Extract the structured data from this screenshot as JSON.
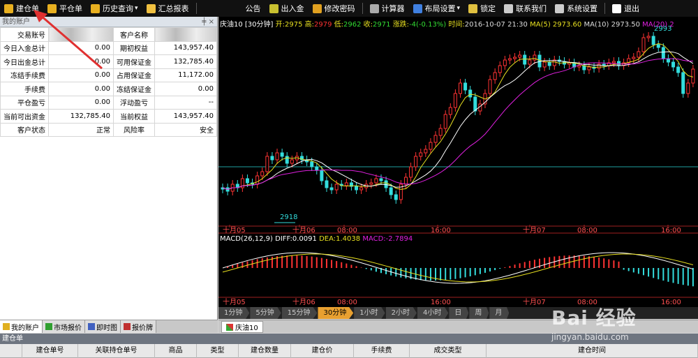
{
  "toolbar": {
    "items": [
      {
        "label": "建仓单",
        "icon": "box-icon",
        "color": "#e8b020"
      },
      {
        "label": "平仓单",
        "icon": "cart-icon",
        "color": "#e8b020"
      },
      {
        "label": "历史查询",
        "icon": "bar-chart-icon",
        "color": "#e8b020",
        "dropdown": "▾"
      },
      {
        "label": "汇总报表",
        "icon": "report-icon",
        "color": "#f0c040"
      },
      {
        "label": "公告",
        "icon": "",
        "color": ""
      },
      {
        "label": "出入金",
        "icon": "money-icon",
        "color": "#c8c030"
      },
      {
        "label": "修改密码",
        "icon": "key-icon",
        "color": "#e0a020"
      },
      {
        "label": "计算器",
        "icon": "calculator-icon",
        "color": "#aaaaaa"
      },
      {
        "label": "布局设置",
        "icon": "layout-icon",
        "color": "#4080e0",
        "dropdown": "▾"
      },
      {
        "label": "锁定",
        "icon": "lock-icon",
        "color": "#e0c040"
      },
      {
        "label": "联系我们",
        "icon": "phone-icon",
        "color": "#cccccc"
      },
      {
        "label": "系统设置",
        "icon": "gear-icon",
        "color": "#cccccc"
      },
      {
        "label": "退出",
        "icon": "power-icon",
        "color": "#ffffff"
      }
    ]
  },
  "account_panel": {
    "title": "我的账户",
    "pin_icons": "ᅟ ╪ ×",
    "rows": [
      {
        "l1": "交易账号",
        "v1": "",
        "l2": "客户名称",
        "v2": ""
      },
      {
        "l1": "今日入金总计",
        "v1": "0.00",
        "l2": "期初权益",
        "v2": "143,957.40"
      },
      {
        "l1": "今日出金总计",
        "v1": "0.00",
        "l2": "可用保证金",
        "v2": "132,785.40"
      },
      {
        "l1": "冻结手续费",
        "v1": "0.00",
        "l2": "占用保证金",
        "v2": "11,172.00"
      },
      {
        "l1": "手续费",
        "v1": "0.00",
        "l2": "冻结保证金",
        "v2": "0.00"
      },
      {
        "l1": "平仓盈亏",
        "v1": "0.00",
        "l2": "浮动盈亏",
        "v2": "--"
      },
      {
        "l1": "当前可出资金",
        "v1": "132,785.40",
        "l2": "当前权益",
        "v2": "143,957.40"
      },
      {
        "l1": "客户状态",
        "v1": "正常",
        "l2": "风险率",
        "v2": "安全"
      }
    ]
  },
  "chart": {
    "header": {
      "symbol": "庆油10 [30分钟]",
      "open_label": "开:",
      "open": "2975",
      "high_label": "高:",
      "high": "2979",
      "low_label": "低:",
      "low": "2962",
      "close_label": "收:",
      "close": "2971",
      "chg_label": "涨跌:",
      "chg": "-4(-0.13%)",
      "time_label": "时间:",
      "time": "2016-10-07 21:30",
      "ma5": "MA(5) 2973.60",
      "ma10": "MA(10) 2973.50",
      "ma20": "MA(20) 2"
    },
    "low_marker": "2918",
    "high_marker": "2993",
    "time_labels": [
      "十月05",
      "十月06",
      "08:00",
      "16:00",
      "十月07",
      "08:00",
      "16:00"
    ],
    "macd_header": {
      "title": "MACD(26,12,9)",
      "diff": "DIFF:0.0091",
      "dea": "DEA:1.4038",
      "macd": "MACD:-2.7894"
    },
    "colors": {
      "up": "#ff3333",
      "down": "#33dddd",
      "ma5": "#ffffff",
      "ma10": "#e8e020",
      "ma20": "#e020e0",
      "hline": "#20a0a0"
    }
  },
  "periods": [
    "1分钟",
    "5分钟",
    "15分钟",
    "30分钟",
    "1小时",
    "2小时",
    "4小时",
    "日",
    "周",
    "月"
  ],
  "active_period": "30分钟",
  "left_tabs": [
    {
      "label": "我的账户",
      "icon": "wallet-icon"
    },
    {
      "label": "市场报价",
      "icon": "quote-icon"
    },
    {
      "label": "即时图",
      "icon": "realtime-icon"
    },
    {
      "label": "报价牌",
      "icon": "board-icon"
    }
  ],
  "chart_tab": "庆油10",
  "bottom": {
    "title": "建仓单",
    "columns": [
      "建仓单号",
      "关联持仓单号",
      "商品",
      "类型",
      "建仓数量",
      "建仓价",
      "手续费",
      "成交类型",
      "建仓时间"
    ]
  },
  "watermark": {
    "logo": "Bai 经验",
    "url": "jingyan.baidu.com"
  }
}
